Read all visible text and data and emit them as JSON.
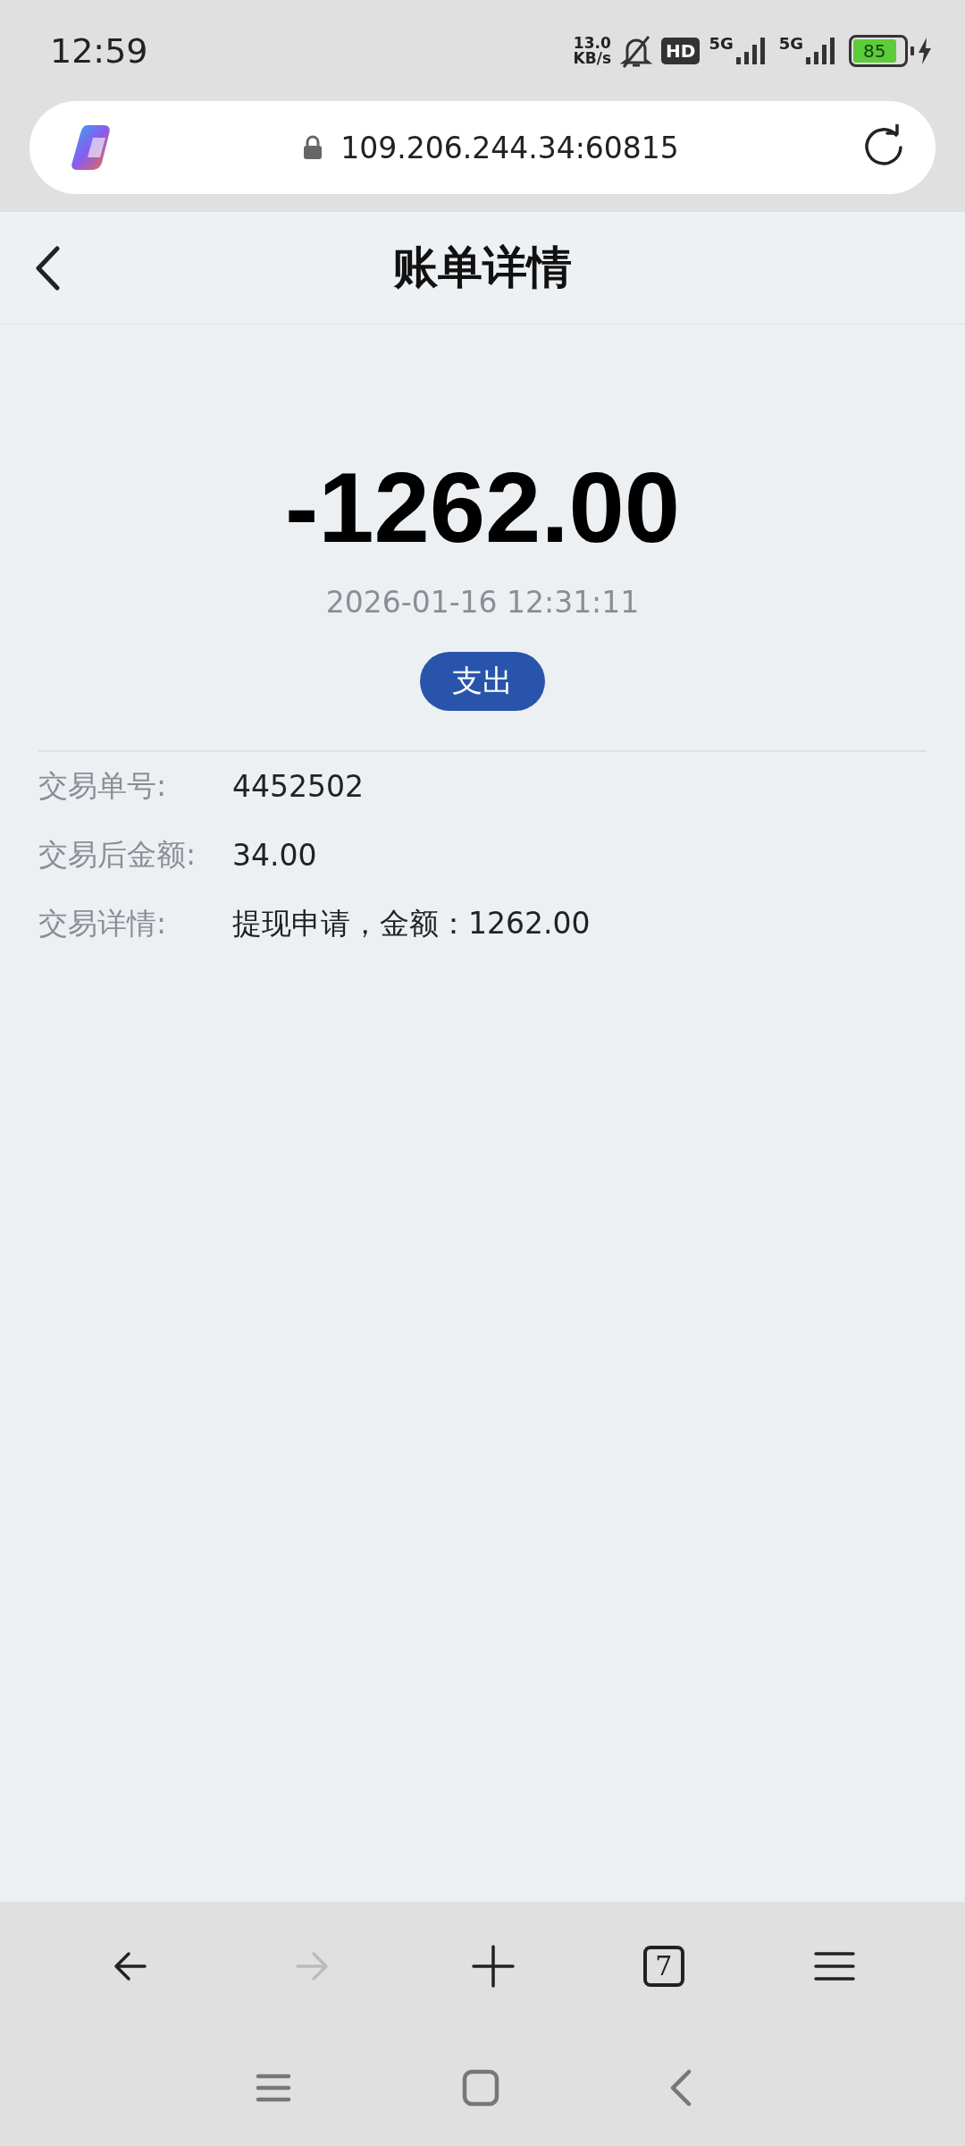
{
  "status_bar": {
    "time": "12:59",
    "net_speed": "13.0",
    "net_unit": "KB/s",
    "muted": true,
    "hd_badge": "HD",
    "sims": [
      {
        "network": "5G"
      },
      {
        "network": "5G"
      }
    ],
    "battery": "85",
    "charging": true
  },
  "address_bar": {
    "url": "109.206.244.34:60815",
    "secure": true
  },
  "header": {
    "title": "账单详情"
  },
  "bill": {
    "amount": "-1262.00",
    "time": "2026-01-16 12:31:11",
    "type_tag": "支出",
    "details": [
      {
        "label": "交易单号:",
        "value": "4452502"
      },
      {
        "label": "交易后金额:",
        "value": "34.00"
      },
      {
        "label": "交易详情:",
        "value": "提现申请，金额：1262.00"
      }
    ]
  },
  "browser_toolbar": [
    {
      "kind": "back",
      "disabled": false
    },
    {
      "kind": "forward",
      "disabled": true
    },
    {
      "kind": "new_tab",
      "disabled": false
    },
    {
      "kind": "tabs",
      "count": "7",
      "disabled": false
    },
    {
      "kind": "menu",
      "disabled": false
    }
  ],
  "nav_bar": [
    {
      "kind": "recents"
    },
    {
      "kind": "home"
    },
    {
      "kind": "back"
    }
  ]
}
